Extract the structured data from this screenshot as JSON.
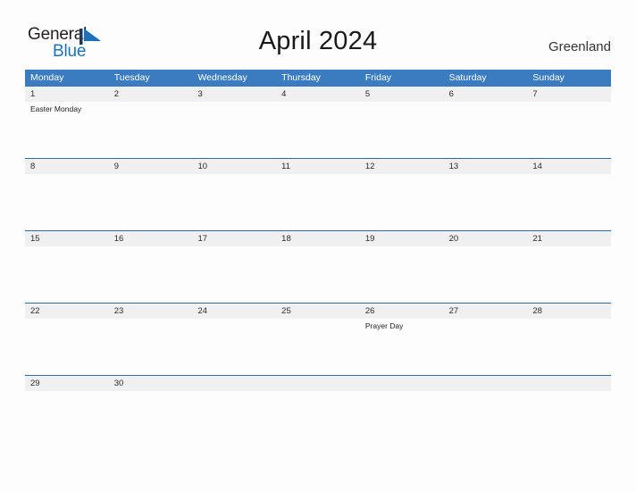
{
  "brand": {
    "name_part1": "General",
    "name_part2": "Blue",
    "mark": "triangle-logo-icon",
    "color_dark": "#231f20",
    "color_blue": "#1f70b8"
  },
  "header": {
    "title": "April 2024",
    "location": "Greenland"
  },
  "colors": {
    "header_blue": "#3b7cc0",
    "row_rule_blue": "#2e6da4",
    "date_band_gray": "#f0f0f0",
    "page_background": "#fdfdfd"
  },
  "calendar": {
    "weekdays": [
      {
        "label": "Monday"
      },
      {
        "label": "Tuesday"
      },
      {
        "label": "Wednesday"
      },
      {
        "label": "Thursday"
      },
      {
        "label": "Friday"
      },
      {
        "label": "Saturday"
      },
      {
        "label": "Sunday"
      }
    ],
    "weeks": [
      {
        "days": [
          {
            "date": "1",
            "event": "Easter Monday"
          },
          {
            "date": "2",
            "event": ""
          },
          {
            "date": "3",
            "event": ""
          },
          {
            "date": "4",
            "event": ""
          },
          {
            "date": "5",
            "event": ""
          },
          {
            "date": "6",
            "event": ""
          },
          {
            "date": "7",
            "event": ""
          }
        ]
      },
      {
        "days": [
          {
            "date": "8",
            "event": ""
          },
          {
            "date": "9",
            "event": ""
          },
          {
            "date": "10",
            "event": ""
          },
          {
            "date": "11",
            "event": ""
          },
          {
            "date": "12",
            "event": ""
          },
          {
            "date": "13",
            "event": ""
          },
          {
            "date": "14",
            "event": ""
          }
        ]
      },
      {
        "days": [
          {
            "date": "15",
            "event": ""
          },
          {
            "date": "16",
            "event": ""
          },
          {
            "date": "17",
            "event": ""
          },
          {
            "date": "18",
            "event": ""
          },
          {
            "date": "19",
            "event": ""
          },
          {
            "date": "20",
            "event": ""
          },
          {
            "date": "21",
            "event": ""
          }
        ]
      },
      {
        "days": [
          {
            "date": "22",
            "event": ""
          },
          {
            "date": "23",
            "event": ""
          },
          {
            "date": "24",
            "event": ""
          },
          {
            "date": "25",
            "event": ""
          },
          {
            "date": "26",
            "event": "Prayer Day"
          },
          {
            "date": "27",
            "event": ""
          },
          {
            "date": "28",
            "event": ""
          }
        ]
      },
      {
        "days": [
          {
            "date": "29",
            "event": ""
          },
          {
            "date": "30",
            "event": ""
          },
          {
            "date": "",
            "event": ""
          },
          {
            "date": "",
            "event": ""
          },
          {
            "date": "",
            "event": ""
          },
          {
            "date": "",
            "event": ""
          },
          {
            "date": "",
            "event": ""
          }
        ]
      }
    ]
  }
}
